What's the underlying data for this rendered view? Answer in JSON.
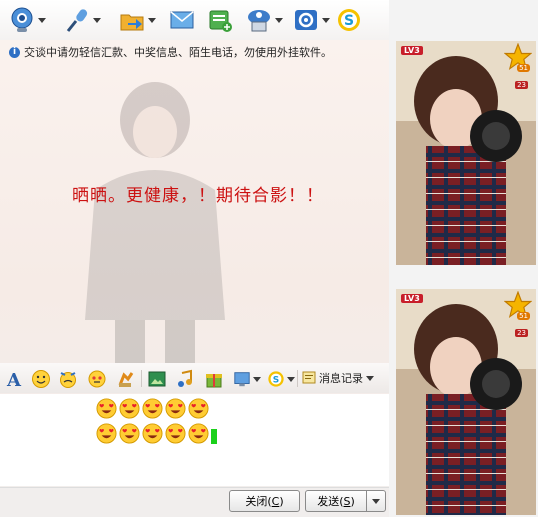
{
  "notice": {
    "text": "交谈中请勿轻信汇款、中奖信息、陌生电话，勿使用外挂软件。"
  },
  "chat": {
    "message": "晒晒。更健康，！期待合影！！"
  },
  "toolbar_input": {
    "history_label": "消息记录"
  },
  "buttons": {
    "close": "关闭(",
    "close_key": "C",
    "close_end": ")",
    "send": "发送(",
    "send_key": "S",
    "send_end": ")"
  },
  "profile": {
    "level": "LV3",
    "stars": "51",
    "volume": "23"
  },
  "emoji_count": 10,
  "icons": [
    "video-icon",
    "microphone-icon",
    "send-file-icon",
    "mail-icon",
    "add-icon",
    "contact-card-icon",
    "settings-icon",
    "s-app-icon",
    "font-icon",
    "smiley-icon",
    "shake-icon",
    "magic-icon",
    "gift-icon",
    "screenshot-icon",
    "music-icon",
    "present-icon",
    "screen-capture-icon",
    "s-app-icon",
    "history-icon"
  ],
  "colors": {
    "message": "#cc1111",
    "accent": "#2e6fc4"
  }
}
